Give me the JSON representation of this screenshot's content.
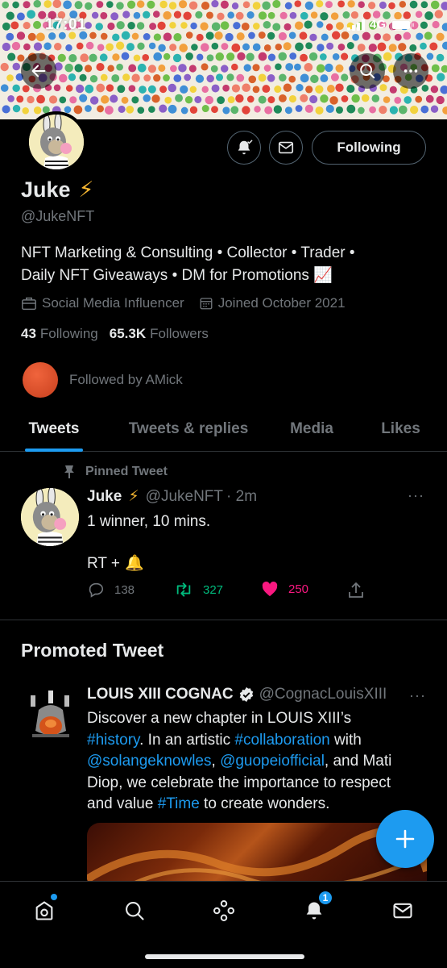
{
  "status_bar": {
    "time": "17:01",
    "network": "4G"
  },
  "banner_controls": {
    "back_icon": "arrow-left-icon",
    "search_icon": "search-icon",
    "more_icon": "more-dots-icon"
  },
  "profile": {
    "name": "Juke",
    "name_emoji": "⚡",
    "handle": "@JukeNFT",
    "bio_line1": "NFT Marketing & Consulting • Collector • Trader •",
    "bio_line2": "Daily NFT Giveaways • DM for Promotions",
    "bio_emoji": "📈",
    "category": "Social Media Influencer",
    "joined": "Joined October 2021",
    "following_count": "43",
    "following_label": "Following",
    "followers_count": "65.3K",
    "followers_label": "Followers",
    "followed_by": "Followed by AMick",
    "follow_button": "Following"
  },
  "tabs": [
    {
      "label": "Tweets",
      "active": true
    },
    {
      "label": "Tweets & replies",
      "active": false
    },
    {
      "label": "Media",
      "active": false
    },
    {
      "label": "Likes",
      "active": false
    }
  ],
  "pinned_tweet": {
    "pinned_label": "Pinned Tweet",
    "name": "Juke",
    "name_emoji": "⚡",
    "handle": "@JukeNFT",
    "time": "· 2m",
    "line1": "1 winner, 10 mins.",
    "line2": "RT +",
    "line2_emoji": "🔔",
    "replies": "138",
    "retweets": "327",
    "likes": "250",
    "more": "···"
  },
  "promoted": {
    "section_title": "Promoted Tweet",
    "name": "LOUIS XIII COGNAC",
    "handle": "@CognacLouisXIII",
    "more": "···",
    "text": {
      "t1": "Discover a new chapter in LOUIS XIII’s",
      "l1": "#history",
      "t2": ". In an artistic ",
      "l2": "#collaboration",
      "t3": " with",
      "l3": "@solangeknowles",
      "t4": ", ",
      "l4": "@guopeiofficial",
      "t5": ", and Mati",
      "t6": "Diop, we celebrate the importance to respect",
      "t7": "and value ",
      "l5": "#Time",
      "t8": " to create wonders."
    }
  },
  "bottom_nav": {
    "notifications_badge": "1"
  },
  "colors": {
    "accent": "#1d9bf0",
    "like": "#f91880",
    "retweet": "#00ba7c",
    "muted": "#71767b",
    "background": "#000000"
  }
}
